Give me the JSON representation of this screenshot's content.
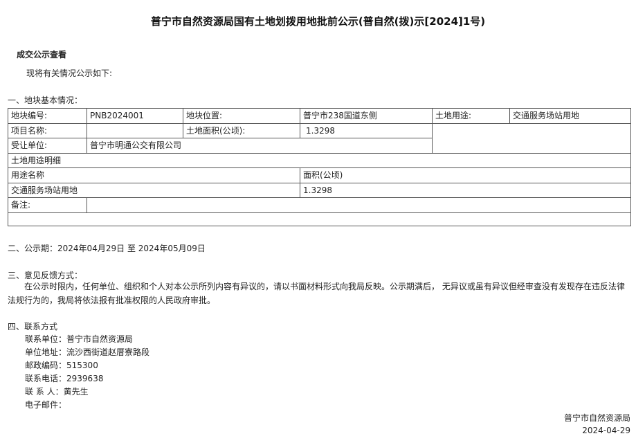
{
  "title": "普宁市自然资源局国有土地划拨用地批前公示(普自然(拨)示[2024]1号)",
  "sub_heading": "成交公示查看",
  "intro": "现将有关情况公示如下:",
  "section1": {
    "heading": "一、地块基本情况：",
    "parcel_no_label": "地块编号:",
    "parcel_no": "PNB2024001",
    "location_label": "地块位置:",
    "location": "普宁市238国道东侧",
    "usage_label": "土地用途:",
    "usage": "交通服务场站用地",
    "project_label": "项目名称:",
    "project": "",
    "area_label": "土地面积(公顷):",
    "area": "1.3298",
    "assignee_label": "受让单位:",
    "assignee": "普宁市明通公交有限公司",
    "detail_heading": "土地用途明细",
    "detail_col_usage": "用途名称",
    "detail_col_area": "面积(公顷)",
    "detail_rows": [
      {
        "usage": "交通服务场站用地",
        "area": "1.3298"
      }
    ],
    "remark_label": "备注:",
    "remark": ""
  },
  "section2": {
    "heading": "二、公示期：",
    "start": "2024年04月29日",
    "to": "至",
    "end": "2024年05月09日"
  },
  "section3": {
    "heading": "三、意见反馈方式：",
    "body": "在公示时限内，任何单位、组织和个人对本公示所列内容有异议的，请以书面材料形式向我局反映。公示期满后， 无异议或虽有异议但经审查没有发现存在违反法律法规行为的，我局将依法报有批准权限的人民政府审批。"
  },
  "section4": {
    "heading": "四、联系方式",
    "items": [
      {
        "label": "联系单位：",
        "value": "普宁市自然资源局"
      },
      {
        "label": "单位地址：",
        "value": "流沙西街道赵厝寮路段"
      },
      {
        "label": "邮政编码：",
        "value": "515300"
      },
      {
        "label": "联系电话：",
        "value": "2939638"
      },
      {
        "label": "联 系 人：",
        "value": "黄先生"
      },
      {
        "label": "电子邮件：",
        "value": ""
      }
    ]
  },
  "footer": {
    "org": "普宁市自然资源局",
    "date": "2024-04-29"
  }
}
